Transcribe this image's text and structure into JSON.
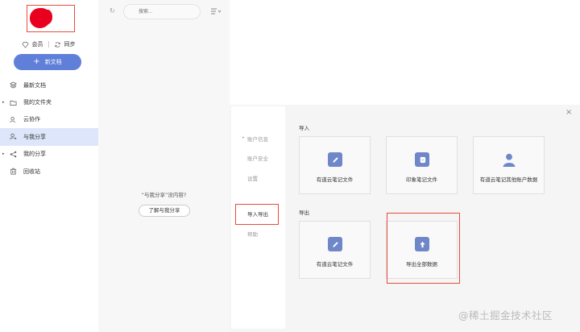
{
  "sidebar": {
    "member_label": "会员",
    "sync_label": "同步",
    "new_doc_label": "新文档",
    "items": [
      {
        "label": "最新文档"
      },
      {
        "label": "我的文件夹"
      },
      {
        "label": "云协作"
      },
      {
        "label": "与我分享"
      },
      {
        "label": "我的分享"
      },
      {
        "label": "回收站"
      }
    ]
  },
  "middle": {
    "search_placeholder": "搜索...",
    "empty_message": "“与我分享”没内容?",
    "learn_button": "了解与我分享"
  },
  "modal": {
    "menu": [
      {
        "label": "账户信息"
      },
      {
        "label": "账户安全"
      },
      {
        "label": "设置"
      },
      {
        "label": "导入导出"
      },
      {
        "label": "帮助"
      }
    ],
    "close_icon": "×",
    "import_title": "导入",
    "import_cards": [
      {
        "label": "有道云笔记文件",
        "icon": "pencil-icon",
        "color": "#6f87c9"
      },
      {
        "label": "印象笔记文件",
        "icon": "evernote-icon",
        "color": "#6f87c9"
      },
      {
        "label": "有道云笔记其他账户数据",
        "icon": "user-icon",
        "color": "#6f87c9"
      }
    ],
    "export_title": "导出",
    "export_cards": [
      {
        "label": "有道云笔记文件",
        "icon": "pencil-icon",
        "color": "#6f87c9"
      },
      {
        "label": "导出全部数据",
        "icon": "upload-icon",
        "color": "#6f87c9"
      }
    ]
  },
  "watermark": "@稀土掘金技术社区"
}
